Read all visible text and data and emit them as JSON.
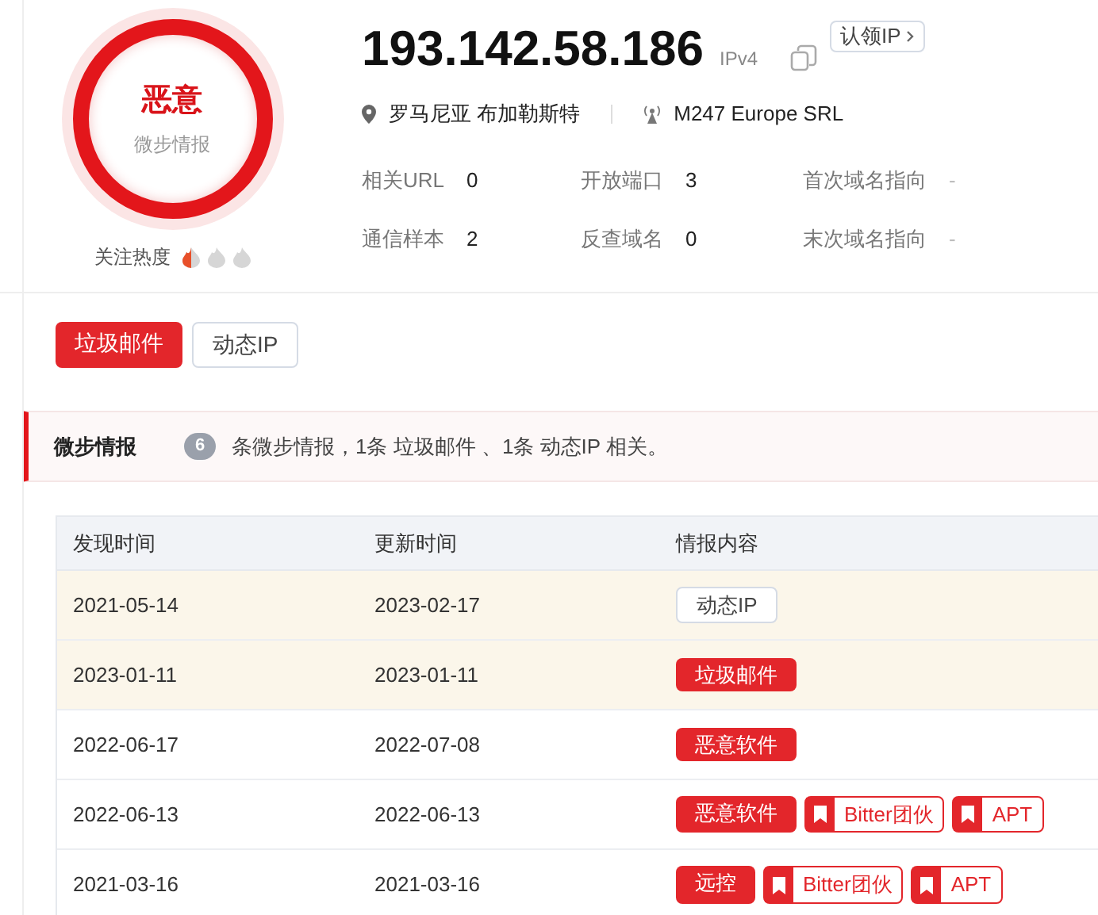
{
  "verdict": {
    "label": "恶意",
    "source": "微步情报"
  },
  "heat": {
    "label": "关注热度",
    "stars": 0.5
  },
  "ip": {
    "address": "193.142.58.186",
    "version": "IPv4",
    "claim_button": "认领IP"
  },
  "location": "罗马尼亚 布加勒斯特",
  "isp": "M247 Europe SRL",
  "stats": [
    {
      "label": "相关URL",
      "value": "0"
    },
    {
      "label": "开放端口",
      "value": "3"
    },
    {
      "label": "首次域名指向",
      "value": "-"
    },
    {
      "label": "通信样本",
      "value": "2"
    },
    {
      "label": "反查域名",
      "value": "0"
    },
    {
      "label": "末次域名指向",
      "value": "-"
    }
  ],
  "tags": [
    {
      "label": "垃圾邮件",
      "kind": "solid"
    },
    {
      "label": "动态IP",
      "kind": "outline"
    }
  ],
  "intel_banner": {
    "title": "微步情报",
    "count": "6",
    "summary": "条微步情报，1条 垃圾邮件 、1条 动态IP 相关。"
  },
  "table": {
    "columns": [
      "发现时间",
      "更新时间",
      "情报内容"
    ],
    "rows": [
      {
        "highlighted": true,
        "found": "2021-05-14",
        "updated": "2023-02-17",
        "tags": [
          {
            "label": "动态IP",
            "kind": "outline"
          }
        ]
      },
      {
        "highlighted": true,
        "found": "2023-01-11",
        "updated": "2023-01-11",
        "tags": [
          {
            "label": "垃圾邮件",
            "kind": "solid"
          }
        ]
      },
      {
        "highlighted": false,
        "found": "2022-06-17",
        "updated": "2022-07-08",
        "tags": [
          {
            "label": "恶意软件",
            "kind": "solid"
          }
        ]
      },
      {
        "highlighted": false,
        "found": "2022-06-13",
        "updated": "2022-06-13",
        "tags": [
          {
            "label": "恶意软件",
            "kind": "solid"
          },
          {
            "label": "Bitter团伙",
            "kind": "bookmark"
          },
          {
            "label": "APT",
            "kind": "bookmark"
          }
        ]
      },
      {
        "highlighted": false,
        "found": "2021-03-16",
        "updated": "2021-03-16",
        "tags": [
          {
            "label": "远控",
            "kind": "solid"
          },
          {
            "label": "Bitter团伙",
            "kind": "bookmark"
          },
          {
            "label": "APT",
            "kind": "bookmark"
          }
        ]
      }
    ]
  }
}
